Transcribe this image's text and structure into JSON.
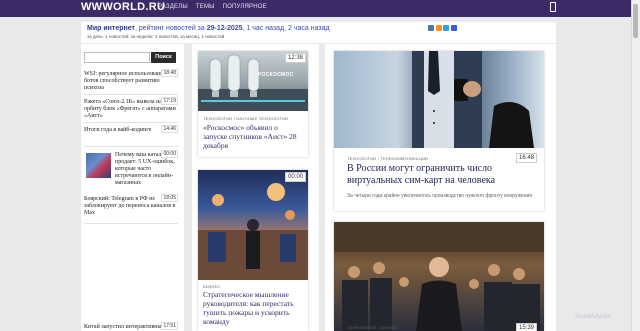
{
  "header": {
    "logo": "WWWORLD.RU",
    "nav": [
      "РАЗДЕЛЫ",
      "ТЕМЫ",
      "ПОПУЛЯРНОЕ"
    ]
  },
  "infobar": {
    "site": "Мир интернет",
    "rating_prefix": ", рейтинг новостей за ",
    "date": "29-12-2025",
    "rating_suffix": ", 1 час назад, 2 часа назад",
    "sub": "за день: 1 новостей, за неделю: 1 новостей, за месяц: 1 новостей"
  },
  "search": {
    "placeholder": "",
    "button": "Поиск"
  },
  "sidebar_news": [
    {
      "time": "18:48",
      "title": "WSJ: регулярное использование чат-ботов способствует развитию психоза"
    },
    {
      "time": "17:19",
      "title": "Ракета «Союз-2.1Б» вывела на орбиту блок «Фрегат» с аппаратами «Аист»"
    },
    {
      "time": "14:46",
      "title": "Итоги года в вайб-кодинге"
    },
    {
      "time": "00:00",
      "title": "Почему ваш каталог продает: 5 UX-ошибок, которые часто встречаются в онлайн-магазинах"
    },
    {
      "time": "18:05",
      "title": "Боярский: Telegram в РФ не заблокируют до переноса каналов в Max"
    },
    {
      "time": "17:51",
      "title": "Китай запустил интерактивный"
    }
  ],
  "mid_cards": [
    {
      "time": "12:38",
      "tag": "ТЕХНОЛОГИИ / НАУЧНЫЕ ТЕХНОЛОГИИ",
      "title": "«Роскосмос» объявил о запуске спутников «Аист» 28 декабря",
      "img_label": "РОСКОСМОС"
    },
    {
      "time": "00:00",
      "tag": "БИЗНЕС",
      "title": "Стратегическое мышление руководителя: как перестать тушить пожары и ускорить команду"
    }
  ],
  "right_cards": [
    {
      "time": "16:48",
      "tag": "ТЕХНОЛОГИИ / ТЕЛЕКОММУНИКАЦИИ",
      "title": "В России могут ограничить число виртуальных сим-карт на человека",
      "lead": "За четыре года крайне увеличилось производство нужного фронту вооружения"
    },
    {
      "time": "15:39",
      "tag": "ТЕХНОЛОГИИ / БИЗНЕС"
    }
  ],
  "watermark": "ScanMalware",
  "colors": {
    "topbar": "#3b2a66",
    "link": "#2d3a8c",
    "vk": "#4a76a8",
    "ok": "#f7931e",
    "telegram": "#2aa3e0",
    "mail": "#3b5bdb"
  }
}
